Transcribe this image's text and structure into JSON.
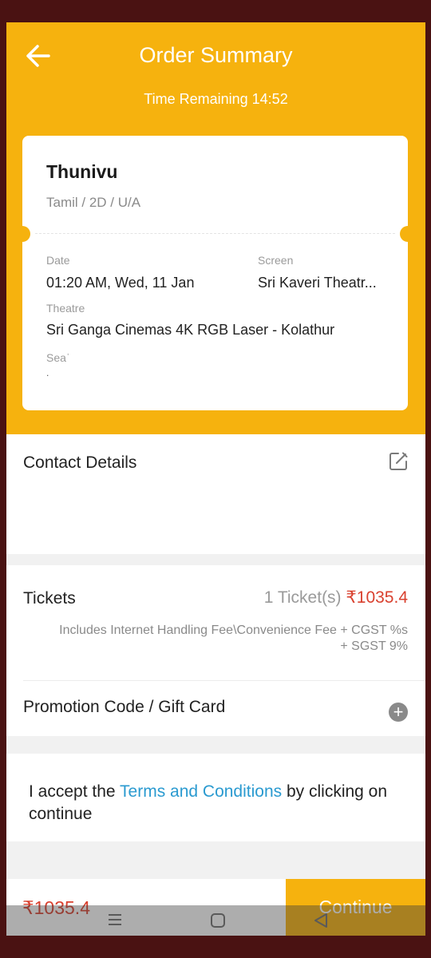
{
  "header": {
    "title": "Order Summary",
    "timer": "Time Remaining 14:52"
  },
  "ticket": {
    "movie_title": "Thunivu",
    "movie_meta": "Tamil / 2D / U/A",
    "date_label": "Date",
    "date_value": "01:20 AM, Wed, 11 Jan",
    "screen_label": "Screen",
    "screen_value": "Sri Kaveri Theatr...",
    "theatre_label": "Theatre",
    "theatre_value": "Sri Ganga Cinemas 4K RGB Laser - Kolathur",
    "seat_label": "Seaˈ",
    "seat_value": "."
  },
  "contact": {
    "title": "Contact Details"
  },
  "tickets": {
    "title": "Tickets",
    "count": "1 Ticket(s)",
    "price": "₹1035.4",
    "fee_line1": "Includes Internet Handling Fee\\Convenience Fee + CGST %s",
    "fee_line2": "+ SGST 9%"
  },
  "promo": {
    "title": "Promotion Code / Gift Card"
  },
  "terms": {
    "prefix": "I accept the ",
    "link": "Terms and Conditions",
    "suffix": " by clicking on continue"
  },
  "footer": {
    "total": "₹1035.4",
    "continue_label": "Continue"
  },
  "colors": {
    "accent": "#f6b20e",
    "price": "#d9412f",
    "link": "#2a9ad0"
  }
}
